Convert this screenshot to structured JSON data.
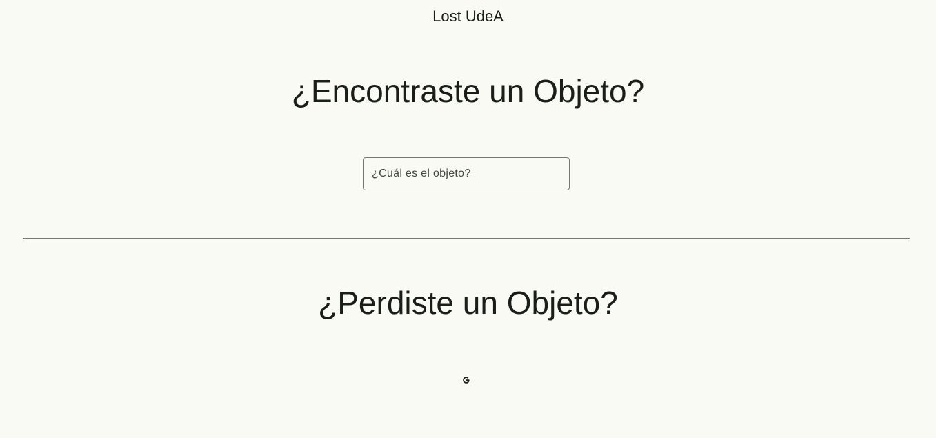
{
  "app": {
    "title": "Lost UdeA"
  },
  "found_section": {
    "heading": "¿Encontraste un Objeto?",
    "search": {
      "placeholder": "¿Cuál es el objeto?",
      "value": ""
    }
  },
  "lost_section": {
    "heading": "¿Perdiste un Objeto?",
    "icon": "google-g-icon"
  },
  "colors": {
    "background": "#f8faf3",
    "text": "#1b1d19",
    "outline": "#74796e"
  }
}
